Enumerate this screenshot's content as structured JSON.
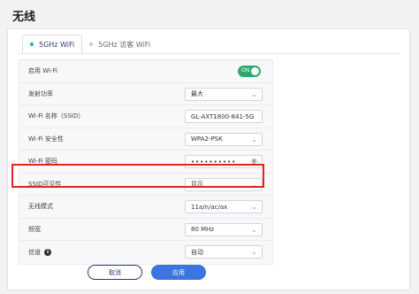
{
  "page_title": "无线",
  "tabs": [
    {
      "label": "5GHz WiFi",
      "active": true
    },
    {
      "label": "5GHz 访客 WiFi",
      "active": false
    }
  ],
  "form": {
    "enable_wifi": {
      "label": "启用 Wi-Fi",
      "value": "ON",
      "enabled": true
    },
    "tx_power": {
      "label": "发射功率",
      "value": "最大"
    },
    "ssid": {
      "label": "Wi-Fi 名称（SSID）",
      "value": "GL-AXT1800-841-5G"
    },
    "security": {
      "label": "Wi-Fi 安全性",
      "value": "WPA2-PSK"
    },
    "password": {
      "label": "Wi-Fi 密码",
      "value": "••••••••••"
    },
    "ssid_visibility": {
      "label": "SSID可见性",
      "value": "显示"
    },
    "mode": {
      "label": "无线模式",
      "value": "11a/n/ac/ax"
    },
    "bandwidth": {
      "label": "频宽",
      "value": "80 MHz"
    },
    "channel": {
      "label": "信道",
      "value": "自动"
    }
  },
  "buttons": {
    "cancel": "取消",
    "apply": "应用"
  },
  "colors": {
    "accent": "#3c74e0",
    "toggle_on": "#2ea86b",
    "highlight": "#e3241d"
  },
  "icons": {
    "chevron": "chevron-down-icon",
    "eye": "eye-icon",
    "info": "info-icon"
  }
}
